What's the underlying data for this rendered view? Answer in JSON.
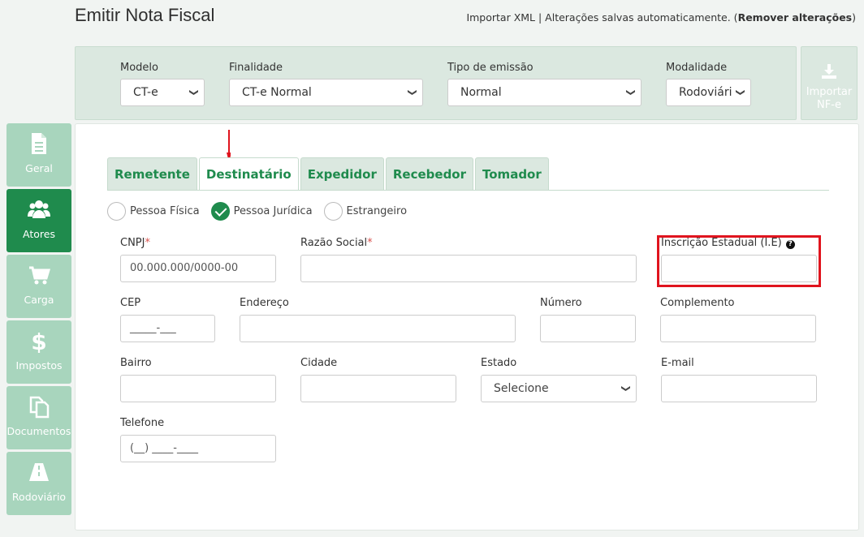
{
  "header": {
    "title": "Emitir Nota Fiscal",
    "import_xml": "Importar XML",
    "separator": " | Alterações salvas automaticamente. (",
    "remove": "Remover alterações",
    "close_paren": ")"
  },
  "params": {
    "modelo": {
      "label": "Modelo",
      "value": "CT-e"
    },
    "finalidade": {
      "label": "Finalidade",
      "value": "CT-e Normal"
    },
    "tipo_emissao": {
      "label": "Tipo de emissão",
      "value": "Normal"
    },
    "modalidade": {
      "label": "Modalidade",
      "value": "Rodoviári"
    }
  },
  "import_button": {
    "line1": "Importar",
    "line2": "NF-e",
    "icon": "download-icon"
  },
  "sidebar": {
    "items": [
      {
        "label": "Geral",
        "icon": "document-icon"
      },
      {
        "label": "Atores",
        "icon": "users-icon"
      },
      {
        "label": "Carga",
        "icon": "cart-icon"
      },
      {
        "label": "Impostos",
        "icon": "dollar-icon"
      },
      {
        "label": "Documentos",
        "icon": "copy-icon"
      },
      {
        "label": "Rodoviário",
        "icon": "road-icon"
      }
    ],
    "active": "Atores"
  },
  "tabs": [
    "Remetente",
    "Destinatário",
    "Expedidor",
    "Recebedor",
    "Tomador"
  ],
  "active_tab": "Destinatário",
  "person_type": {
    "options": [
      "Pessoa Física",
      "Pessoa Jurídica",
      "Estrangeiro"
    ],
    "selected": "Pessoa Jurídica"
  },
  "form": {
    "cnpj": {
      "label": "CNPJ",
      "req": "*",
      "placeholder": "00.000.000/0000-00"
    },
    "razao_social": {
      "label": "Razão Social",
      "req": "*",
      "value": ""
    },
    "ie": {
      "label": "Inscrição Estadual (I.E)",
      "help": "?",
      "value": ""
    },
    "cep": {
      "label": "CEP",
      "placeholder": "_____-___"
    },
    "endereco": {
      "label": "Endereço",
      "value": ""
    },
    "numero": {
      "label": "Número",
      "value": ""
    },
    "complemento": {
      "label": "Complemento",
      "value": ""
    },
    "bairro": {
      "label": "Bairro",
      "value": ""
    },
    "cidade": {
      "label": "Cidade",
      "value": ""
    },
    "estado": {
      "label": "Estado",
      "value": "Selecione"
    },
    "email": {
      "label": "E-mail",
      "value": ""
    },
    "telefone": {
      "label": "Telefone",
      "placeholder": "(__) ____-____"
    }
  },
  "colors": {
    "accent": "#1f8b4d",
    "sidebar_inactive": "#a8d5bd",
    "highlight": "#e0141e"
  }
}
